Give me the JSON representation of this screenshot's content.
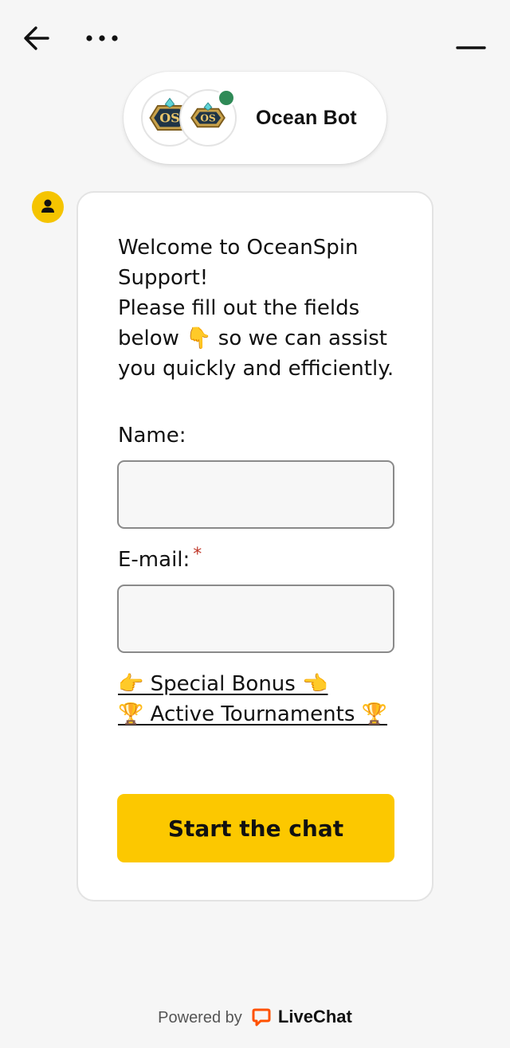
{
  "header": {
    "back_icon": "arrow-left-icon",
    "more_icon": "ellipsis-icon",
    "minimize_icon": "minimize-icon"
  },
  "agent": {
    "name": "Ocean Bot",
    "status_color": "#2f8a57",
    "avatar_text": "OS"
  },
  "message": {
    "welcome_lines": [
      "Welcome to OceanSpin",
      "Support!",
      "Please fill out the fields",
      "below 👇 so we can assist",
      "you quickly and efficiently."
    ],
    "form": {
      "name_label": "Name:",
      "name_value": "",
      "email_label": "E-mail:",
      "email_required_mark": "*",
      "email_value": ""
    },
    "links": {
      "special_bonus": "👉 Special Bonus 👈",
      "active_tournaments": "🏆 Active Tournaments 🏆"
    },
    "submit_label": "Start the chat"
  },
  "footer": {
    "powered_by": "Powered by",
    "brand": "LiveChat"
  },
  "colors": {
    "accent": "#fcc800",
    "background": "#f6f6f6",
    "required": "#c0392b",
    "brand": "#ff5100"
  }
}
